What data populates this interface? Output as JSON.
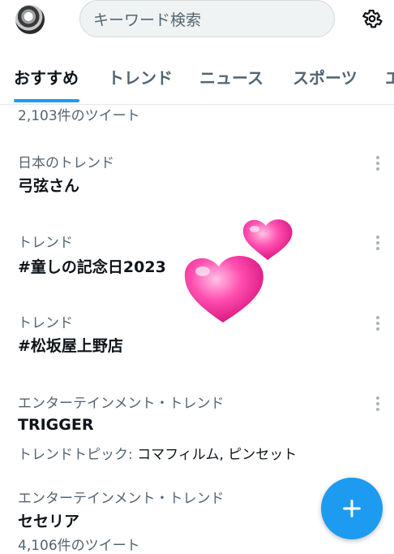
{
  "header": {
    "search_placeholder": "キーワード検索"
  },
  "tabs": [
    {
      "label": "おすすめ"
    },
    {
      "label": "トレンド"
    },
    {
      "label": "ニュース"
    },
    {
      "label": "スポーツ"
    },
    {
      "label": "エ"
    }
  ],
  "trends": {
    "top_count": "2,103件のツイート",
    "items": [
      {
        "meta": "日本のトレンド",
        "title": "弓弦さん"
      },
      {
        "meta": "トレンド",
        "title": "#童しの記念日2023"
      },
      {
        "meta": "トレンド",
        "title": "#松坂屋上野店"
      },
      {
        "meta": "エンターテインメント・トレンド",
        "title": "TRIGGER",
        "topic_label": "トレンドトピック: ",
        "topic_value": "コマフィルム, ピンセット"
      },
      {
        "meta": "エンターテインメント・トレンド",
        "title": "セセリア",
        "count": "4,106件のツイート"
      }
    ]
  },
  "colors": {
    "accent": "#1d9bf0",
    "heart": "#ff4fb0"
  },
  "icons": {
    "settings": "gear-icon",
    "compose": "plus-icon",
    "overflow": "more-vertical-icon"
  }
}
